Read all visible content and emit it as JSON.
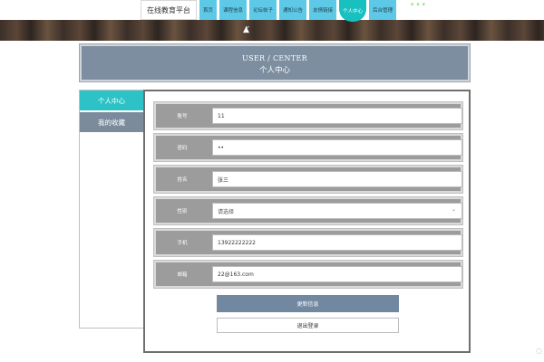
{
  "site": {
    "brand": "在线教育平台",
    "banner_text": "...",
    "nav": [
      "首页",
      "课程信息",
      "论坛帖子",
      "通知公告",
      "友情链接",
      "个人中心",
      "后台管理"
    ],
    "active_nav": "个人中心"
  },
  "header": {
    "en": "USER / CENTER",
    "zh": "个人中心"
  },
  "sidebar": {
    "items": [
      {
        "label": "个人中心"
      },
      {
        "label": "我的收藏"
      }
    ]
  },
  "form": {
    "fields": [
      {
        "label": "账号",
        "value": "11"
      },
      {
        "label": "密码",
        "value": "••"
      },
      {
        "label": "姓名",
        "value": "张三"
      },
      {
        "label": "性别",
        "value": "请选择"
      },
      {
        "label": "手机",
        "value": "13922222222"
      },
      {
        "label": "邮箱",
        "value": "22@163.com"
      }
    ],
    "update_label": "更新信息",
    "logout_label": "退出登录"
  },
  "colors": {
    "accent": "#2dc3c6",
    "header": "#7d8ea0",
    "nav": "#5ec9e6",
    "button": "#7288a1"
  }
}
